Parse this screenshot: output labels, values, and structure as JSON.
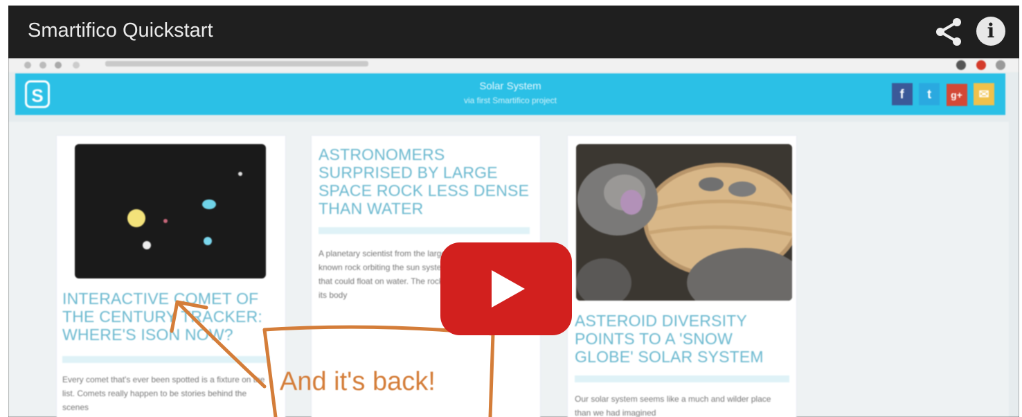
{
  "video": {
    "title": "Smartifico Quickstart",
    "share_icon": "share-icon",
    "info_label": "i",
    "play_icon": "play-button-icon"
  },
  "browser": {
    "icons": [
      "back-icon",
      "forward-icon",
      "refresh-icon",
      "lock-icon"
    ],
    "extension_colors": [
      "#555555",
      "#d43a2a",
      "#999999"
    ]
  },
  "site": {
    "logo_letter": "S",
    "title": "Solar System",
    "subtitle": "via first Smartifico project",
    "colors": {
      "header": "#2bc0e6",
      "facebook": "#3b5998",
      "twitter": "#2aa9e0",
      "googleplus": "#d34836",
      "email": "#f0c14b"
    },
    "social": [
      {
        "name": "facebook",
        "label": "f"
      },
      {
        "name": "twitter",
        "label": "t"
      },
      {
        "name": "googleplus",
        "label": "g+"
      },
      {
        "name": "email",
        "label": "✉"
      }
    ]
  },
  "cards": [
    {
      "title": "INTERACTIVE COMET OF THE CENTURY TRACKER: WHERE'S ISON NOW?",
      "excerpt": "Every comet that's ever been spotted is a fixture on the list. Comets really happen to be stories behind the scenes"
    },
    {
      "title": "ASTRONOMERS SURPRISED BY LARGE SPACE ROCK LESS DENSE THAN WATER",
      "excerpt": "A planetary scientist from the largest known rock orbiting the sun system that could float on water. The rock and its body"
    },
    {
      "title": "ASTEROID DIVERSITY POINTS TO A 'SNOW GLOBE' SOLAR SYSTEM",
      "excerpt": "Our solar system seems like a much and wilder place than we had imagined"
    }
  ],
  "callout": {
    "text": "And it's back!",
    "color": "#d47d39"
  }
}
